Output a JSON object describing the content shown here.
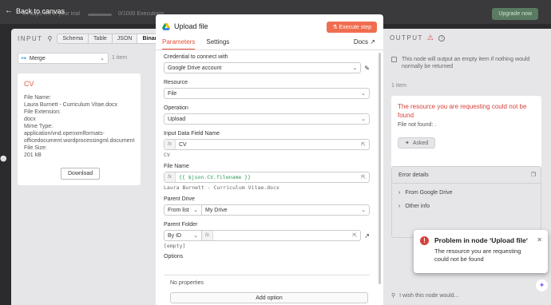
{
  "topbar": {
    "back_label": "Back to canvas",
    "trial_text": "14 days left in your trial",
    "executions_text": "0/1000 Executions",
    "upgrade_label": "Upgrade now"
  },
  "input": {
    "title": "INPUT",
    "tabs": [
      "Schema",
      "Table",
      "JSON",
      "Binary"
    ],
    "active_tab": "Binary",
    "node_select": "Merge",
    "item_count": "1 item",
    "card": {
      "title": "CV",
      "rows": [
        "File Name:",
        "Laura Burnett - Curriculum Vitae.docx",
        "File Extension:",
        "docx",
        "Mime Type:",
        "application/vnd.openxmlformats-",
        "officedocument.wordprocessingml.document",
        "File Size:",
        "201 kB"
      ],
      "download_label": "Download"
    }
  },
  "node": {
    "title": "Upload file",
    "execute_label": "Execute step",
    "tabs": [
      "Parameters",
      "Settings"
    ],
    "active_tab": "Parameters",
    "docs_label": "Docs",
    "fields": {
      "credential": {
        "label": "Credential to connect with",
        "value": "Google Drive account"
      },
      "resource": {
        "label": "Resource",
        "value": "File"
      },
      "operation": {
        "label": "Operation",
        "value": "Upload"
      },
      "input_field": {
        "label": "Input Data Field Name",
        "value": "CV",
        "hint": "CV"
      },
      "file_name": {
        "label": "File Name",
        "value": "{{ $json.CV.filename }}",
        "hint": "Laura Burnett - Curriculum Vitae.docx"
      },
      "parent_drive": {
        "label": "Parent Drive",
        "mode": "From list",
        "value": "My Drive"
      },
      "parent_folder": {
        "label": "Parent Folder",
        "mode": "By ID",
        "value": "",
        "hint": "[empty]"
      },
      "options": {
        "label": "Options",
        "empty": "No properties",
        "add_label": "Add option"
      }
    }
  },
  "output": {
    "title": "OUTPUT",
    "note": "This node will output an empty item if nothing would normally be returned",
    "item_count": "1 item",
    "error": {
      "title": "The resource you are requesting could not be found",
      "detail": "File not found: .",
      "asked_label": "Asked"
    },
    "details": {
      "title": "Error details",
      "rows": [
        "From Google Drive",
        "Other info"
      ]
    },
    "wish": "I wish this node would..."
  },
  "toast": {
    "title": "Problem in node ‘Upload file‘",
    "body": "The resource you are requesting could not be found"
  }
}
